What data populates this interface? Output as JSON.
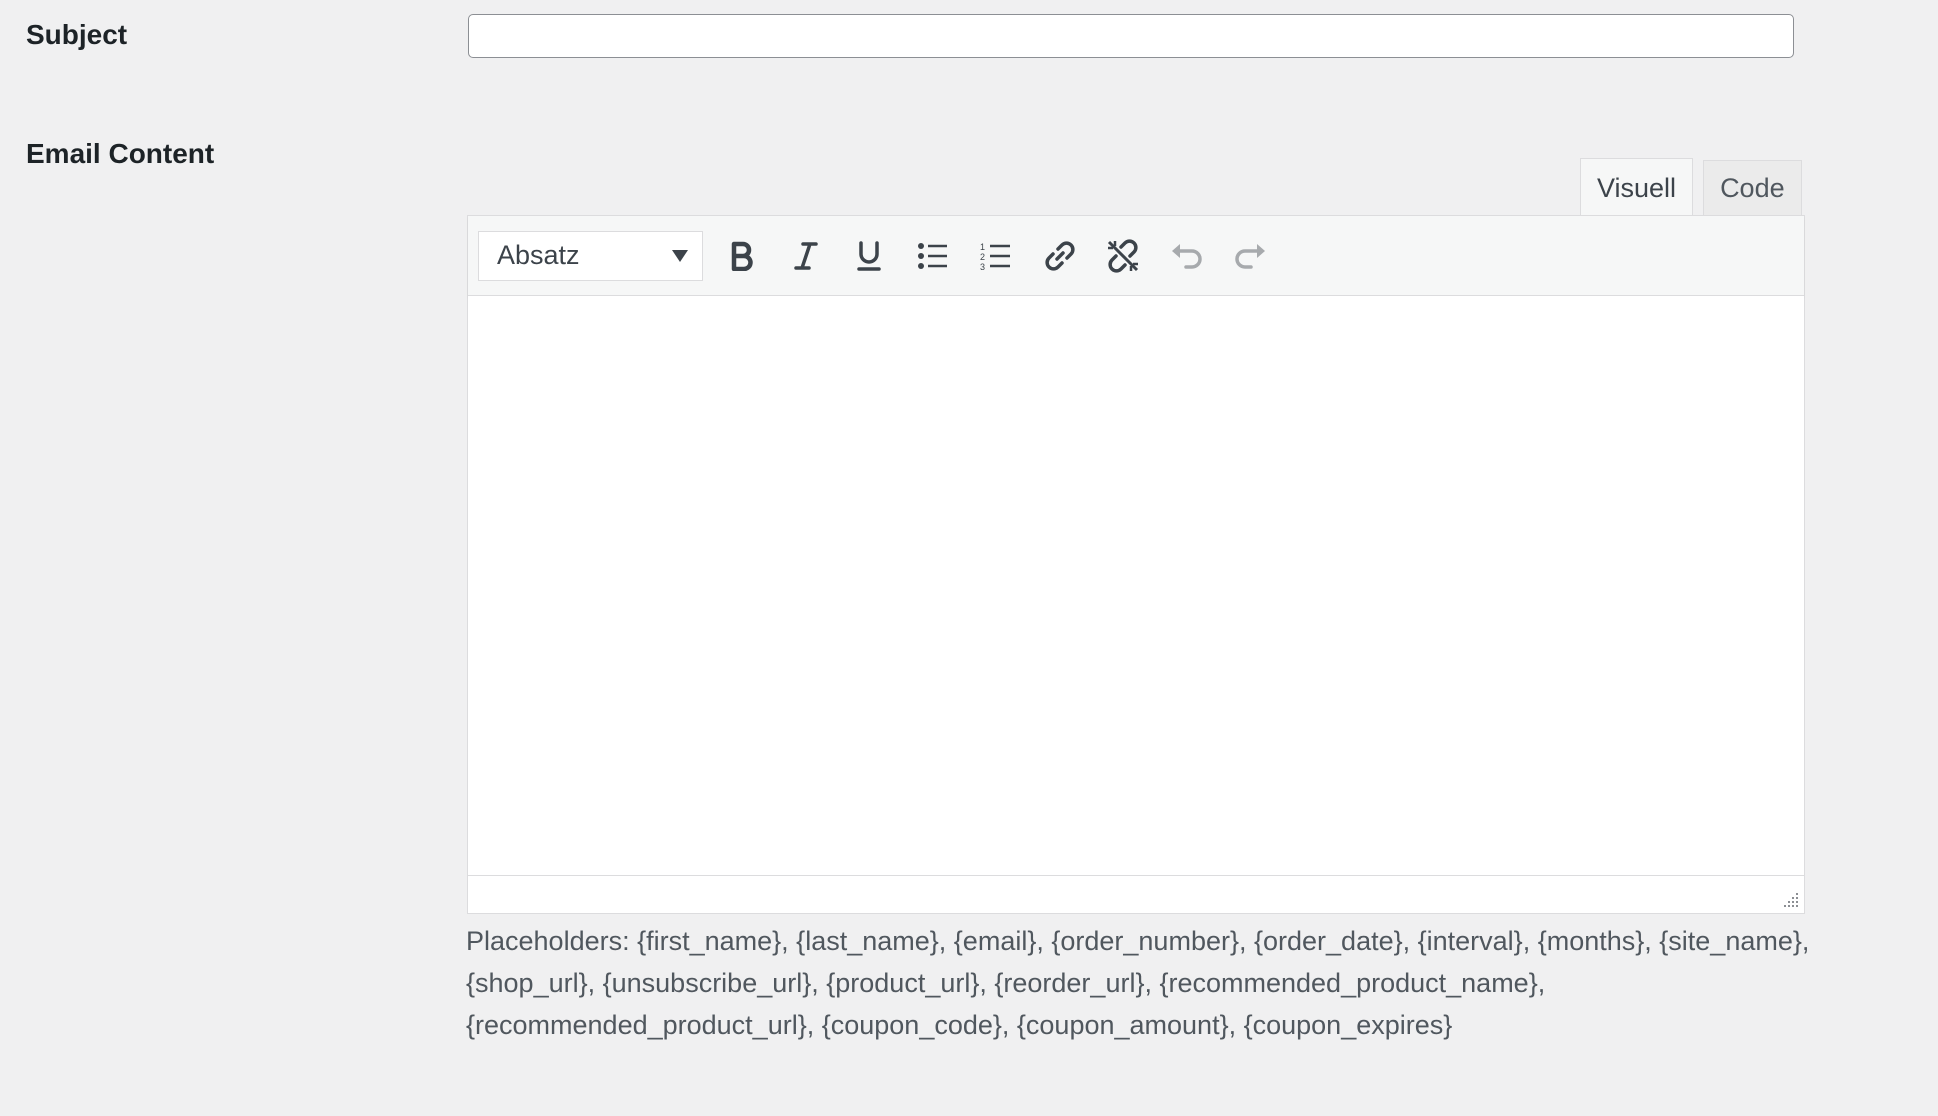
{
  "subject": {
    "label": "Subject",
    "value": "",
    "placeholder": ""
  },
  "email_content": {
    "label": "Email Content",
    "tabs": [
      {
        "label": "Visuell",
        "active": true
      },
      {
        "label": "Code",
        "active": false
      }
    ],
    "toolbar": {
      "format_select": "Absatz",
      "buttons": [
        {
          "name": "bold-icon",
          "title": "Bold"
        },
        {
          "name": "italic-icon",
          "title": "Italic"
        },
        {
          "name": "underline-icon",
          "title": "Underline"
        },
        {
          "name": "bulleted-list-icon",
          "title": "Bulleted list"
        },
        {
          "name": "numbered-list-icon",
          "title": "Numbered list"
        },
        {
          "name": "link-icon",
          "title": "Insert link"
        },
        {
          "name": "unlink-icon",
          "title": "Remove link"
        },
        {
          "name": "undo-icon",
          "title": "Undo"
        },
        {
          "name": "redo-icon",
          "title": "Redo"
        }
      ]
    },
    "body": ""
  },
  "placeholders_text": "Placeholders: {first_name}, {last_name}, {email}, {order_number}, {order_date}, {interval}, {months}, {site_name}, {shop_url}, {unsubscribe_url}, {product_url}, {reorder_url}, {recommended_product_name}, {recommended_product_url}, {coupon_code}, {coupon_amount}, {coupon_expires}",
  "colors": {
    "background": "#f0f0f1",
    "text": "#1d2327",
    "muted_text": "#50575e",
    "border": "#dcdcde",
    "toolbar_bg": "#f6f7f7",
    "disabled_icon": "#a7aaad"
  }
}
